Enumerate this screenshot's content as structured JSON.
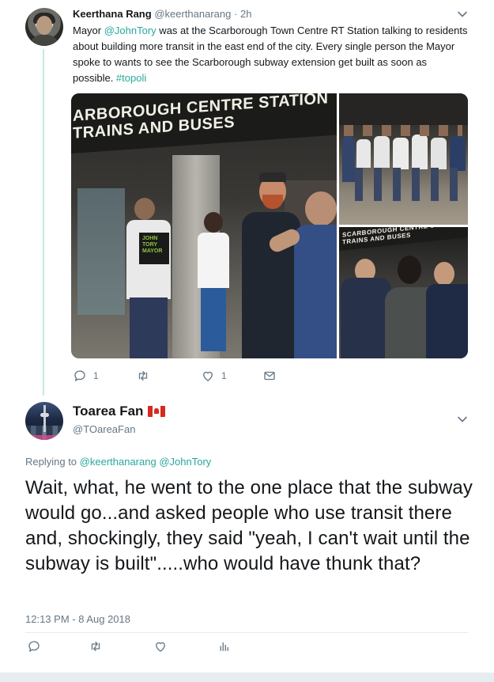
{
  "reply_tweet": {
    "author_name": "Keerthana Rang",
    "author_handle": "@keerthanarang",
    "separator": "·",
    "time": "2h",
    "text_before": "Mayor ",
    "mention": "@JohnTory",
    "text_after": " was at the Scarborough Town Centre RT Station talking to residents about building more transit in the east end of the city. Every single person the Mayor spoke to wants to see the Scarborough subway extension get built as soon as possible. ",
    "hashtag": "#topoli",
    "photo_sign_main": "ARBOROUGH CENTRE STATION\nTRAINS AND BUSES",
    "photo_sign_small": "SCARBOROUGH CENTRE STATION\nTRAINS AND BUSES",
    "shirt_text": "JOHN TORY MAYOR",
    "actions": {
      "reply_count": "1",
      "retweet_count": "",
      "like_count": "1"
    }
  },
  "main_tweet": {
    "author_name": "Toarea Fan",
    "author_handle": "@TOareaFan",
    "replying_label": "Replying to ",
    "replying_to_1": "@keerthanarang",
    "replying_to_2": "@JohnTory",
    "text": "Wait, what, he went to the one place that the subway would go...and asked people who use transit there and, shockingly, they said \"yeah, I can't wait until the subway is built\".....who would have thunk that?",
    "timestamp": "12:13 PM - 8 Aug 2018"
  },
  "colors": {
    "accent": "#2aa89a",
    "muted": "#657786",
    "thread_line": "#c4ecdf",
    "divider": "#e6ecf0"
  },
  "icons": [
    "reply-icon",
    "retweet-icon",
    "like-icon",
    "dm-icon",
    "analytics-icon",
    "chevron-down-icon"
  ]
}
